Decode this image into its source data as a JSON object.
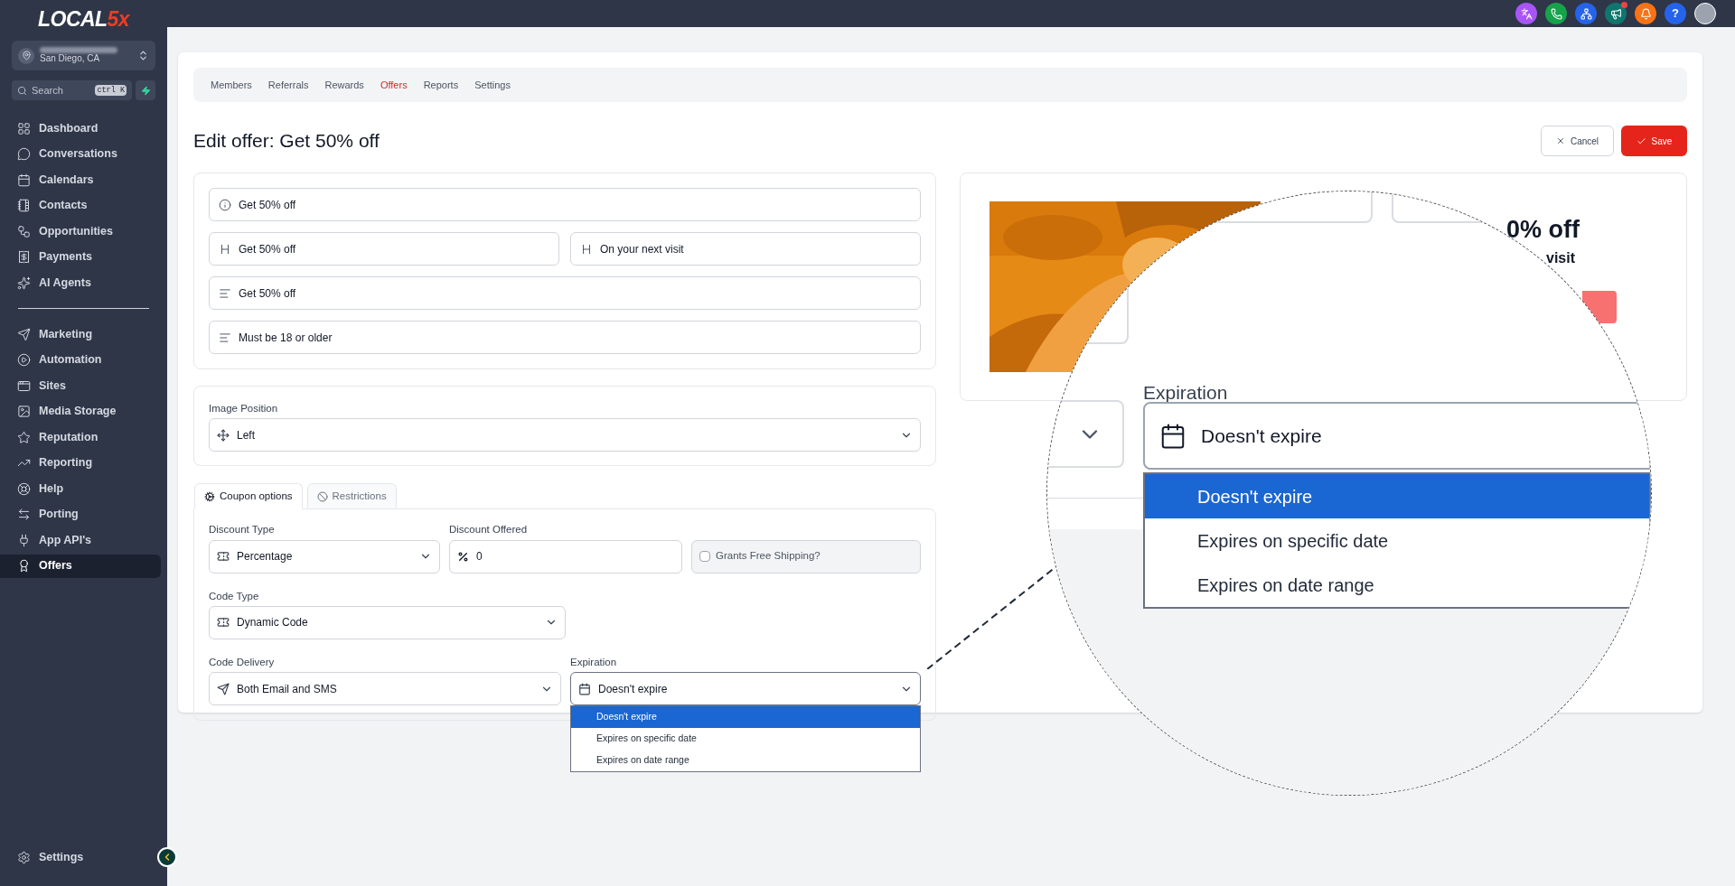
{
  "sidebar": {
    "brand": {
      "text": "LOCAL",
      "accent": "5x"
    },
    "account": {
      "location": "San Diego, CA"
    },
    "search": {
      "placeholder": "Search",
      "shortcut": "ctrl K"
    },
    "groups": [
      [
        {
          "label": "Dashboard",
          "selected": false
        },
        {
          "label": "Conversations",
          "selected": false
        },
        {
          "label": "Calendars",
          "selected": false
        },
        {
          "label": "Contacts",
          "selected": false
        },
        {
          "label": "Opportunities",
          "selected": false
        },
        {
          "label": "Payments",
          "selected": false
        },
        {
          "label": "AI Agents",
          "selected": false
        }
      ],
      [
        {
          "label": "Marketing",
          "selected": false
        },
        {
          "label": "Automation",
          "selected": false
        },
        {
          "label": "Sites",
          "selected": false
        },
        {
          "label": "Media Storage",
          "selected": false
        },
        {
          "label": "Reputation",
          "selected": false
        },
        {
          "label": "Reporting",
          "selected": false
        },
        {
          "label": "Help",
          "selected": false
        },
        {
          "label": "Porting",
          "selected": false
        },
        {
          "label": "App API's",
          "selected": false
        },
        {
          "label": "Offers",
          "selected": true
        }
      ]
    ],
    "footer": {
      "label": "Settings"
    }
  },
  "topbar": {
    "icons": [
      {
        "kind": "translate",
        "color": "#a855f7",
        "badge": false
      },
      {
        "kind": "phone",
        "color": "#16a34a",
        "badge": false
      },
      {
        "kind": "network",
        "color": "#2563eb",
        "badge": false
      },
      {
        "kind": "megaphone",
        "color": "#0f766e",
        "badge": true
      },
      {
        "kind": "bell",
        "color": "#f97316",
        "badge": false
      },
      {
        "kind": "help",
        "color": "#2563eb",
        "label": "?",
        "badge": false
      }
    ]
  },
  "nav": [
    {
      "label": "Members",
      "selected": false
    },
    {
      "label": "Referrals",
      "selected": false
    },
    {
      "label": "Rewards",
      "selected": false
    },
    {
      "label": "Offers",
      "selected": true
    },
    {
      "label": "Reports",
      "selected": false
    },
    {
      "label": "Settings",
      "selected": false
    }
  ],
  "title": "Edit offer: Get 50% off",
  "actions": {
    "cancel": "Cancel",
    "save": "Save"
  },
  "content_fields": [
    [
      {
        "kind": "info",
        "value": "Get 50% off"
      }
    ],
    [
      {
        "kind": "heading",
        "value": "Get 50% off"
      },
      {
        "kind": "heading",
        "value": "On your next visit"
      }
    ],
    [
      {
        "kind": "text",
        "value": "Get 50% off"
      }
    ],
    [
      {
        "kind": "text",
        "value": "Must be 18 or older"
      }
    ]
  ],
  "image_position": {
    "label": "Image Position",
    "value": "Left"
  },
  "tabs": [
    {
      "label": "Coupon options",
      "selected": true
    },
    {
      "label": "Restrictions",
      "selected": false
    }
  ],
  "coupon": {
    "discount_type": {
      "label": "Discount Type",
      "value": "Percentage"
    },
    "discount_offered": {
      "label": "Discount Offered",
      "value": "0"
    },
    "free_shipping": {
      "label": "Grants Free Shipping?",
      "checked": false
    },
    "code_type": {
      "label": "Code Type",
      "value": "Dynamic Code"
    },
    "code_delivery": {
      "label": "Code Delivery",
      "value": "Both Email and SMS"
    },
    "expiration": {
      "label": "Expiration",
      "value": "Doesn't expire",
      "open": true,
      "options": [
        {
          "label": "Doesn't expire",
          "selected": true
        },
        {
          "label": "Expires on specific date",
          "selected": false
        },
        {
          "label": "Expires on date range",
          "selected": false
        }
      ]
    }
  },
  "preview": {
    "title": "0% off",
    "subtitle": "visit"
  },
  "magnifier": {
    "label": "Expiration",
    "value": "Doesn't expire",
    "options": [
      {
        "label": "Doesn't expire",
        "selected": true
      },
      {
        "label": "Expires on specific date",
        "selected": false
      },
      {
        "label": "Expires on date range",
        "selected": false
      }
    ]
  }
}
